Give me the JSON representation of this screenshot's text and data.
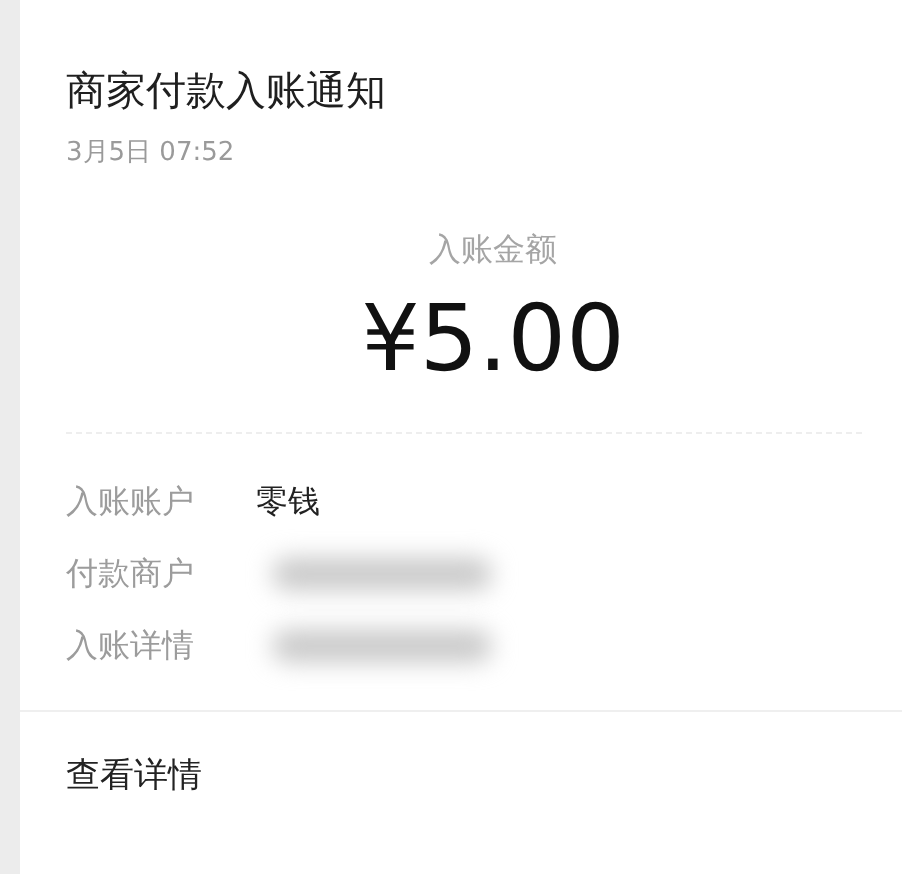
{
  "notification": {
    "title": "商家付款入账通知",
    "time": "3月5日  07:52"
  },
  "amount": {
    "label": "入账金额",
    "value": "¥5.00"
  },
  "details": [
    {
      "kind": "text",
      "label": "入账账户",
      "value": "零钱"
    },
    {
      "kind": "blurred",
      "label": "付款商户"
    },
    {
      "kind": "blurred",
      "label": "入账详情"
    }
  ],
  "footer": {
    "link": "查看详情"
  }
}
